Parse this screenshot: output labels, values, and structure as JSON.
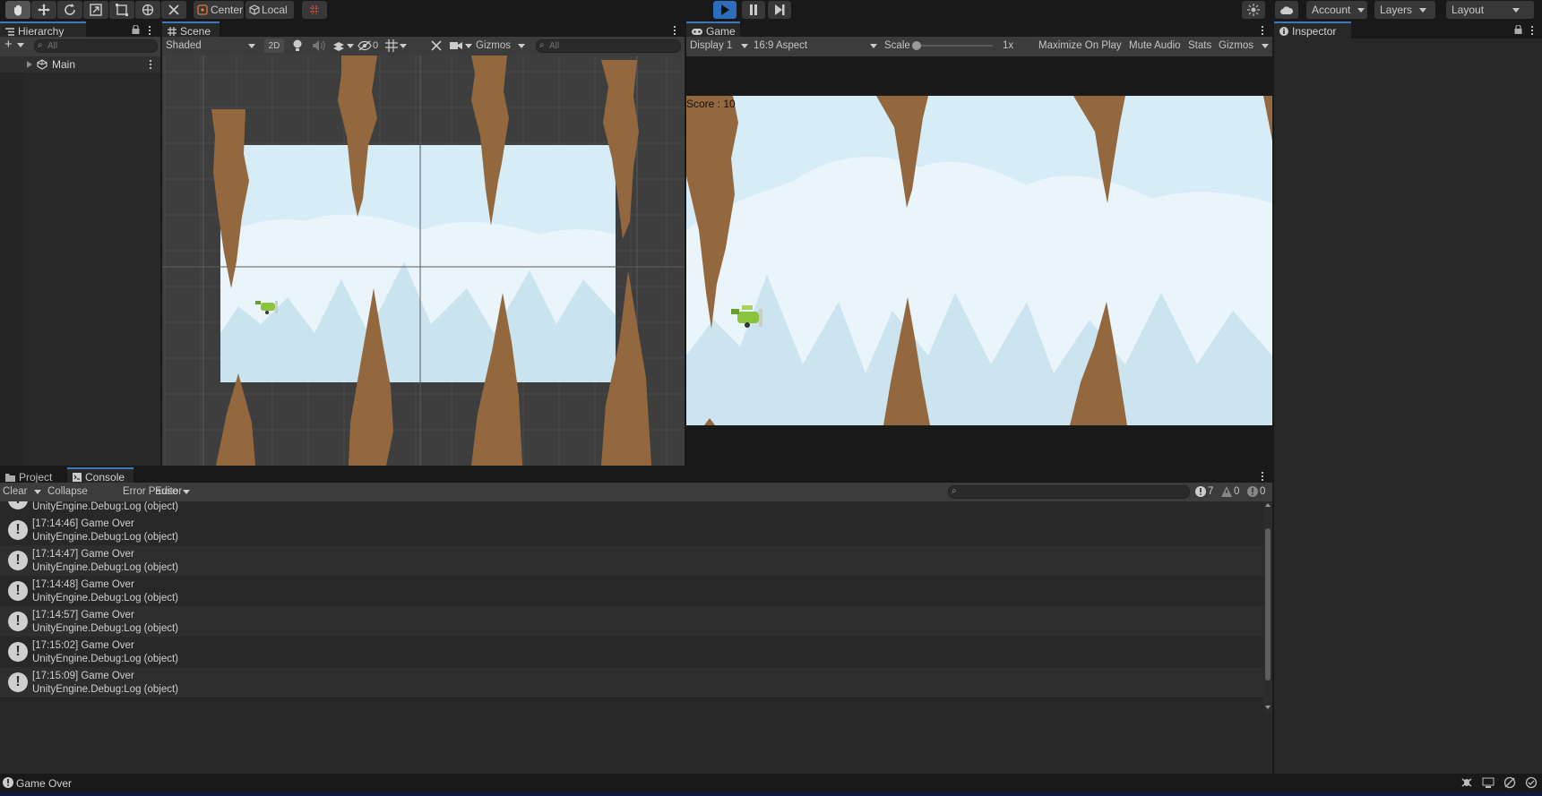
{
  "toolbar": {
    "pivot_label": "Center",
    "space_label": "Local",
    "account_label": "Account",
    "layers_label": "Layers",
    "layout_label": "Layout"
  },
  "hierarchy": {
    "tab_label": "Hierarchy",
    "search_placeholder": "All",
    "scene_name": "Main"
  },
  "scene": {
    "tab_label": "Scene",
    "shading_mode": "Shaded",
    "mode_2d": "2D",
    "hidden_count": "0",
    "gizmos_label": "Gizmos",
    "search_placeholder": "All"
  },
  "game": {
    "tab_label": "Game",
    "display": "Display 1",
    "aspect": "16:9 Aspect",
    "scale_label": "Scale",
    "scale_value": "1x",
    "scale_level": 0,
    "maximize_label": "Maximize On Play",
    "mute_label": "Mute Audio",
    "stats_label": "Stats",
    "gizmos_label": "Gizmos",
    "score_text": "Score : 10"
  },
  "inspector": {
    "tab_label": "Inspector"
  },
  "bottom_tabs": {
    "project_label": "Project",
    "console_label": "Console"
  },
  "console": {
    "clear_label": "Clear",
    "collapse_label": "Collapse",
    "error_pause_label": "Error Pause",
    "editor_label": "Editor",
    "log_count": "7",
    "warn_count": "0",
    "error_count": "0",
    "partial_row_text": "UnityEngine.Debug:Log (object)",
    "entries": [
      {
        "message": "[17:14:46] Game Over",
        "trace": "UnityEngine.Debug:Log (object)"
      },
      {
        "message": "[17:14:47] Game Over",
        "trace": "UnityEngine.Debug:Log (object)"
      },
      {
        "message": "[17:14:48] Game Over",
        "trace": "UnityEngine.Debug:Log (object)"
      },
      {
        "message": "[17:14:57] Game Over",
        "trace": "UnityEngine.Debug:Log (object)"
      },
      {
        "message": "[17:15:02] Game Over",
        "trace": "UnityEngine.Debug:Log (object)"
      },
      {
        "message": "[17:15:09] Game Over",
        "trace": "UnityEngine.Debug:Log (object)"
      }
    ]
  },
  "status_bar": {
    "message": "Game Over"
  },
  "colors": {
    "accent": "#3a79bb",
    "play_active": "#2d6dbd",
    "sky": "#d6ecf6",
    "rock": "#93683f",
    "plane": "#8ac43c"
  }
}
